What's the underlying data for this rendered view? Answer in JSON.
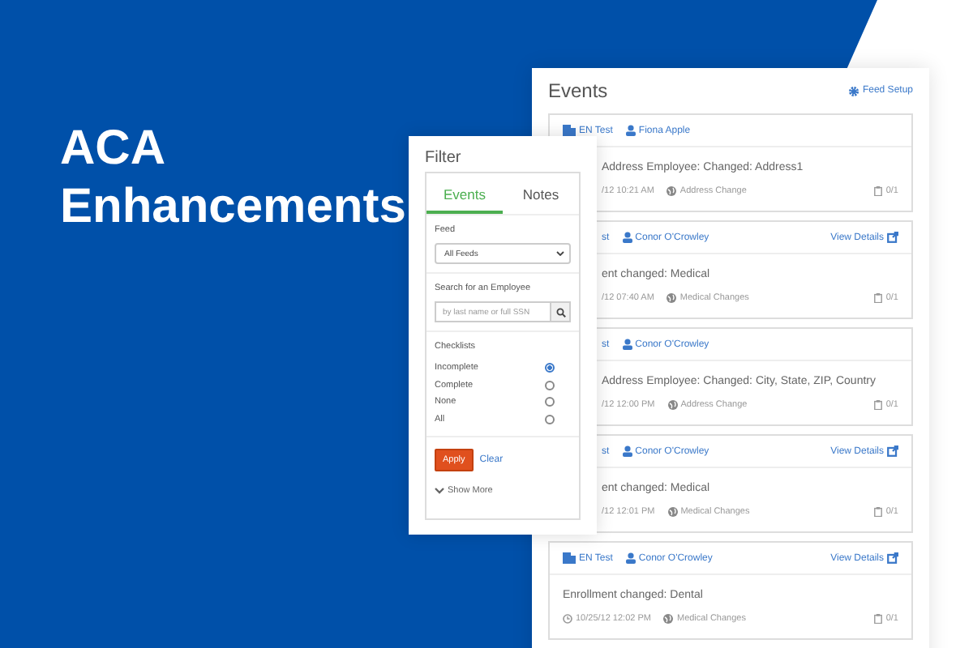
{
  "headline": [
    "ACA",
    "Enhancements"
  ],
  "events": {
    "title": "Events",
    "feed_setup": "Feed Setup",
    "cards": [
      {
        "source": "EN Test",
        "person": "Fiona Apple",
        "header_clipped": false,
        "body_clipped": true,
        "message": "Address Employee: Changed: Address1",
        "time": "/12 10:21 AM",
        "category": "Address Change",
        "count": "0/1"
      },
      {
        "source": "st",
        "person": "Conor O'Crowley",
        "view_details": "View Details",
        "header_clipped": true,
        "body_clipped": true,
        "message": "ent changed: Medical",
        "time": "/12 07:40 AM",
        "category": "Medical Changes",
        "count": "0/1"
      },
      {
        "source": "st",
        "person": "Conor O'Crowley",
        "header_clipped": true,
        "body_clipped": true,
        "message": "Address Employee: Changed: City, State, ZIP, Country",
        "time": "/12 12:00 PM",
        "category": "Address Change",
        "count": "0/1"
      },
      {
        "source": "st",
        "person": "Conor O'Crowley",
        "view_details": "View Details",
        "header_clipped": true,
        "body_clipped": true,
        "message": "ent changed: Medical",
        "time": "/12 12:01 PM",
        "category": "Medical Changes",
        "count": "0/1"
      },
      {
        "source": "EN Test",
        "person": "Conor O'Crowley",
        "view_details": "View Details",
        "header_clipped": false,
        "body_clipped": false,
        "message": "Enrollment changed: Dental",
        "time": "10/25/12 12:02 PM",
        "category": "Medical Changes",
        "count": "0/1"
      }
    ]
  },
  "filter": {
    "title": "Filter",
    "tabs": [
      {
        "label": "Events",
        "selected": true
      },
      {
        "label": "Notes",
        "selected": false
      }
    ],
    "feed_label": "Feed",
    "feed_value": "All Feeds",
    "search_label": "Search for an Employee",
    "search_placeholder": "by last name or full SSN",
    "checklists_label": "Checklists",
    "checklists": [
      {
        "label": "Incomplete",
        "selected": true
      },
      {
        "label": "Complete",
        "selected": false
      },
      {
        "label": "None",
        "selected": false
      },
      {
        "label": "All",
        "selected": false
      }
    ],
    "apply": "Apply",
    "clear": "Clear",
    "show_more": "Show More"
  }
}
